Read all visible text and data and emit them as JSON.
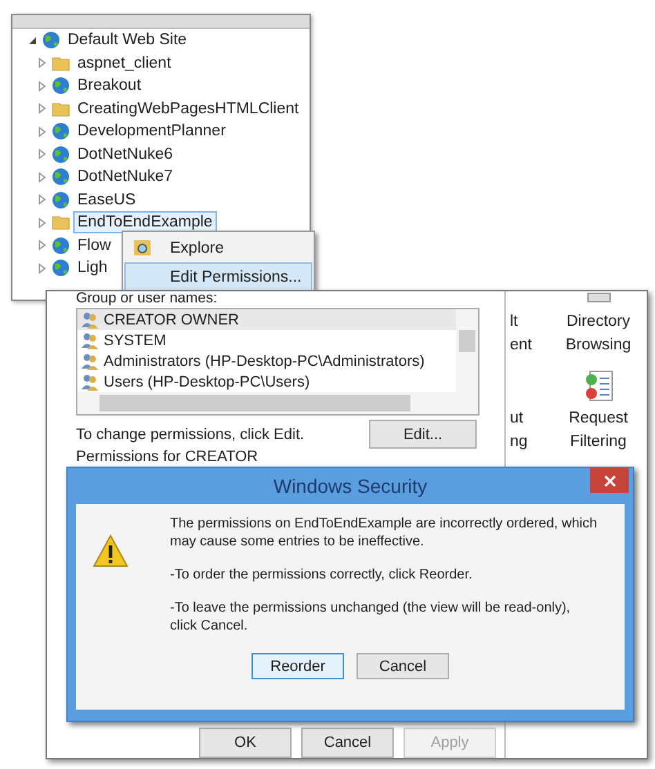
{
  "tree": {
    "label": "Default Web Site",
    "expanded": true,
    "children": [
      {
        "label": "aspnet_client",
        "kind": "folder",
        "selected": false
      },
      {
        "label": "Breakout",
        "kind": "app",
        "selected": false
      },
      {
        "label": "CreatingWebPagesHTMLClient",
        "kind": "folder",
        "selected": false
      },
      {
        "label": "DevelopmentPlanner",
        "kind": "app",
        "selected": false
      },
      {
        "label": "DotNetNuke6",
        "kind": "app",
        "selected": false
      },
      {
        "label": "DotNetNuke7",
        "kind": "app",
        "selected": false
      },
      {
        "label": "EaseUS",
        "kind": "app",
        "selected": false
      },
      {
        "label": "EndToEndExample",
        "kind": "folder",
        "selected": true
      },
      {
        "label": "Flow",
        "kind": "app",
        "selected": false
      },
      {
        "label": "Ligh",
        "kind": "app",
        "selected": false
      }
    ]
  },
  "context_menu": {
    "items": [
      {
        "label": "Explore",
        "selected": false
      },
      {
        "label": "Edit Permissions...",
        "selected": true
      }
    ]
  },
  "permissions_dialog": {
    "group_label": "Group or user names:",
    "users": [
      {
        "name": "CREATOR OWNER",
        "selected": true
      },
      {
        "name": "SYSTEM",
        "selected": false
      },
      {
        "name": "Administrators (HP-Desktop-PC\\Administrators)",
        "selected": false
      },
      {
        "name": "Users (HP-Desktop-PC\\Users)",
        "selected": false
      }
    ],
    "change_hint": "To change permissions, click Edit.",
    "edit_button": "Edit...",
    "permissions_for": "Permissions for CREATOR",
    "buttons": [
      {
        "label": "OK",
        "disabled": false
      },
      {
        "label": "Cancel",
        "disabled": false
      },
      {
        "label": "Apply",
        "disabled": true
      }
    ]
  },
  "features": [
    {
      "kind": "plain",
      "lines": [
        "lt",
        "ent"
      ]
    },
    {
      "kind": "browse",
      "lines": [
        "Directory",
        "Browsing"
      ]
    },
    {
      "kind": "plain",
      "lines": [
        "ut",
        "ng"
      ]
    },
    {
      "kind": "filter",
      "lines": [
        "Request",
        "Filtering"
      ]
    }
  ],
  "security_dialog": {
    "title": "Windows Security",
    "paragraphs": [
      "The permissions on EndToEndExample are incorrectly ordered, which may cause some entries to be ineffective.",
      "-To order the permissions correctly, click Reorder.",
      "-To leave the permissions unchanged (the view will be read-only), click Cancel."
    ],
    "buttons": [
      {
        "label": "Reorder",
        "selected": true
      },
      {
        "label": "Cancel",
        "selected": false
      }
    ]
  }
}
